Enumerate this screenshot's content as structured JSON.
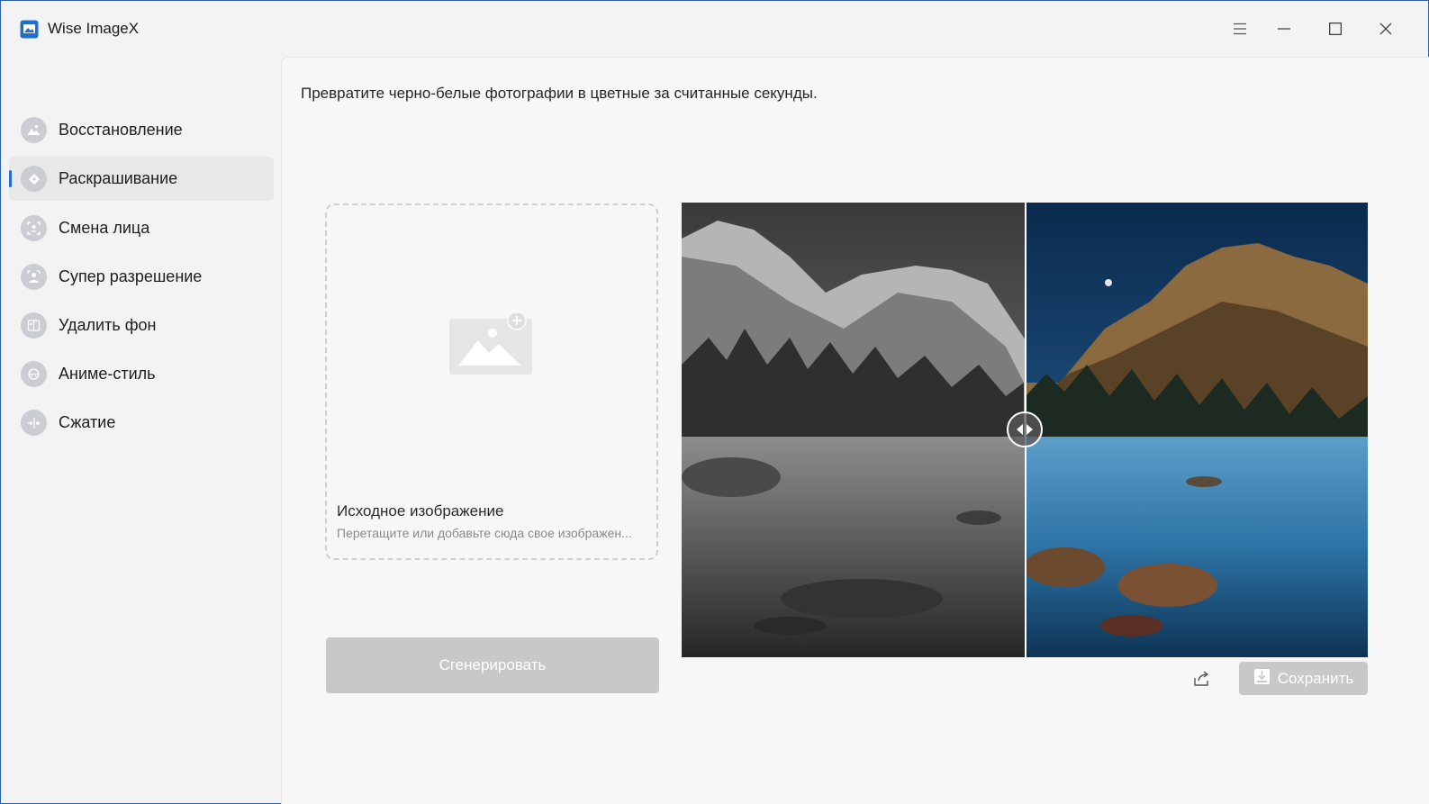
{
  "app": {
    "title": "Wise ImageX",
    "logo_icon": "wise-imagex-logo",
    "accent": "#1f6fd1"
  },
  "window_controls": [
    {
      "name": "menu-icon"
    },
    {
      "name": "minimize-icon"
    },
    {
      "name": "maximize-icon"
    },
    {
      "name": "close-icon"
    }
  ],
  "sidebar": {
    "active_index": 1,
    "items": [
      {
        "label": "Восстановление",
        "icon": "mountain-icon"
      },
      {
        "label": "Раскрашивание",
        "icon": "paint-bucket-icon"
      },
      {
        "label": "Смена лица",
        "icon": "face-swap-icon"
      },
      {
        "label": "Супер разрешение",
        "icon": "super-resolution-icon"
      },
      {
        "label": "Удалить фон",
        "icon": "remove-background-icon"
      },
      {
        "label": "Аниме-стиль",
        "icon": "anime-style-icon"
      },
      {
        "label": "Сжатие",
        "icon": "compress-icon"
      }
    ]
  },
  "main": {
    "subtitle": "Превратите черно-белые фотографии в цветные за считанные секунды.",
    "dropzone": {
      "title": "Исходное изображение",
      "hint": "Перетащите или добавьте сюда свое изображен..."
    },
    "generate_label": "Сгенерировать",
    "save_label": "Сохранить",
    "share_icon": "share-icon",
    "compare_handle_icon": "compare-arrows-icon",
    "disabled_button_color": "#c8c8c8"
  }
}
